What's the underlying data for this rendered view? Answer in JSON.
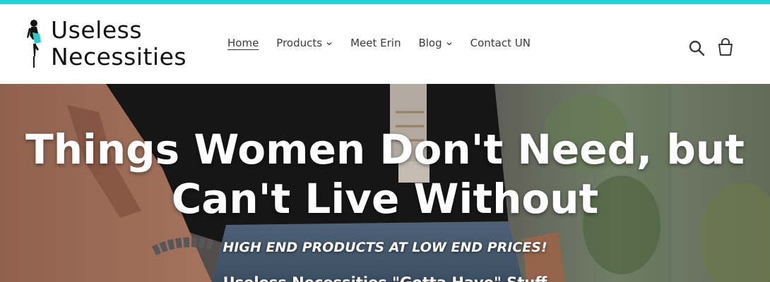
{
  "theme": {
    "accent": "#1dd3d3",
    "text": "#3a3a3a"
  },
  "brand": {
    "line1": "Useless",
    "line2": "Necessities"
  },
  "nav": {
    "items": [
      {
        "label": "Home",
        "active": true
      },
      {
        "label": "Products",
        "dropdown": true
      },
      {
        "label": "Meet Erin"
      },
      {
        "label": "Blog",
        "dropdown": true
      },
      {
        "label": "Contact UN"
      }
    ]
  },
  "header_icons": {
    "search": "search-icon",
    "cart": "cart-icon"
  },
  "hero": {
    "title_line1": "Things Women Don't Need, but",
    "title_line2": "Can't Live Without",
    "subtitle": "HIGH END PRODUCTS AT LOW END PRICES!",
    "tagline": "Useless Necessities \"Gotta Have\" Stuff"
  }
}
